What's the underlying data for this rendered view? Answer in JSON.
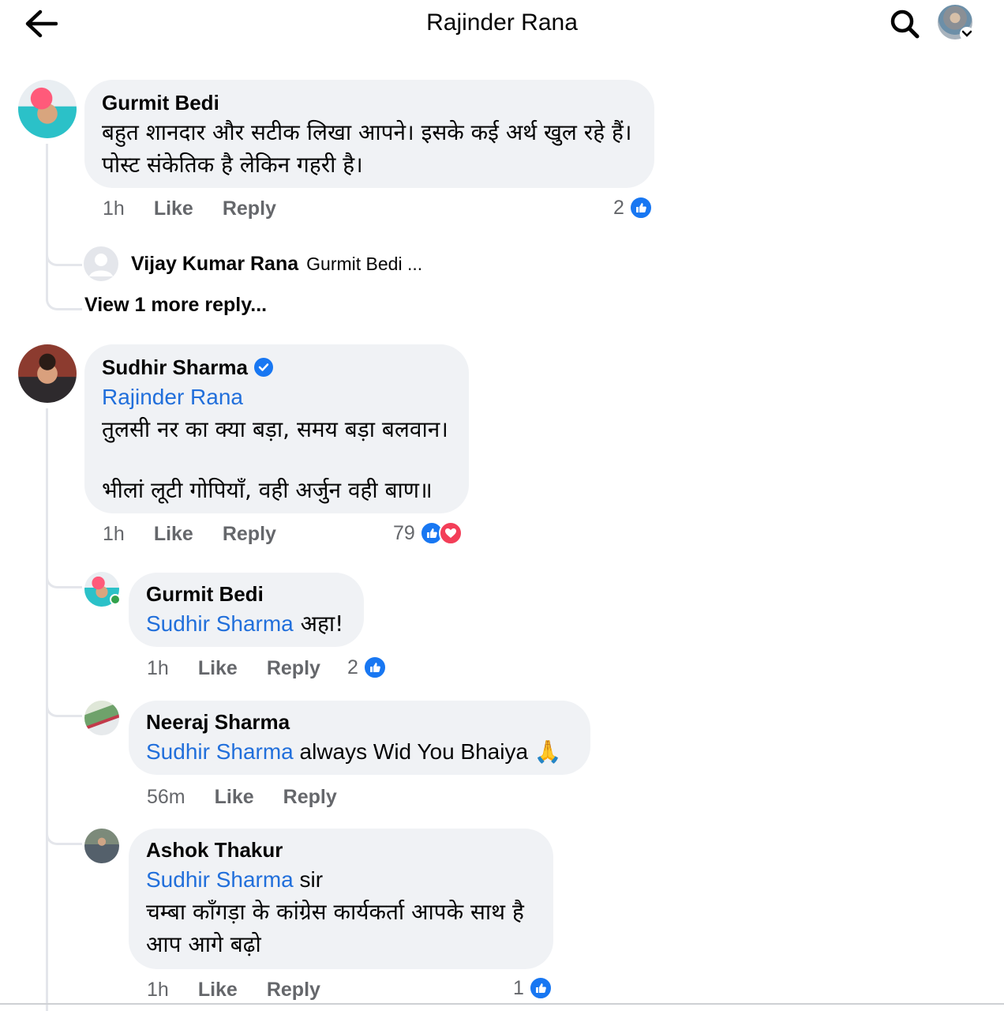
{
  "header": {
    "title": "Rajinder Rana",
    "back_icon": "arrow-left-icon",
    "search_icon": "search-icon"
  },
  "comments": [
    {
      "author": "Gurmit Bedi",
      "text_line1": "बहुत शानदार और सटीक लिखा आपने। इसके कई अर्थ खुल रहे हैं।",
      "text_line2": "पोस्ट संकेतिक है लेकिन गहरी है।",
      "time": "1h",
      "like_label": "Like",
      "reply_label": "Reply",
      "reactions": "2",
      "reply_preview": {
        "author": "Vijay Kumar Rana",
        "text": "Gurmit Bedi ..."
      },
      "view_more": "View 1 more reply..."
    },
    {
      "author": "Sudhir Sharma",
      "verified": true,
      "mention": "Rajinder Rana",
      "text_line1": "तुलसी नर का क्या बड़ा, समय बड़ा बलवान।",
      "text_line2": "भीलां लूटी गोपियाँ, वही अर्जुन वही बाण॥",
      "time": "1h",
      "like_label": "Like",
      "reply_label": "Reply",
      "reactions": "79",
      "replies": [
        {
          "author": "Gurmit Bedi",
          "mention": "Sudhir Sharma",
          "text": " अहा!",
          "time": "1h",
          "like_label": "Like",
          "reply_label": "Reply",
          "reactions": "2",
          "online": true
        },
        {
          "author": "Neeraj Sharma",
          "mention": "Sudhir Sharma",
          "text": " always Wid You Bhaiya 🙏",
          "time": "56m",
          "like_label": "Like",
          "reply_label": "Reply"
        },
        {
          "author": "Ashok Thakur",
          "mention": "Sudhir Sharma",
          "text": " sir",
          "text_line2": "चम्बा काँगड़ा के कांग्रेस कार्यकर्ता आपके साथ है",
          "text_line3": "आप आगे बढ़ो",
          "time": "1h",
          "like_label": "Like",
          "reply_label": "Reply",
          "reactions": "1"
        }
      ]
    }
  ],
  "colors": {
    "link": "#216fdb",
    "like": "#1877f2",
    "love": "#f33e58",
    "bubble": "#f0f2f5",
    "meta": "#65676b"
  }
}
